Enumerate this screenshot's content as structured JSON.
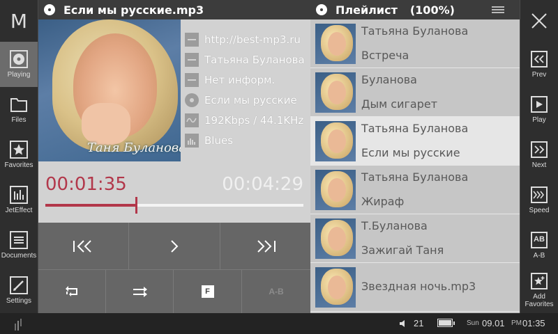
{
  "app": {
    "logo": "M"
  },
  "header": {
    "track_title": "Если мы русские.mp3",
    "playlist_label": "Плейлист",
    "playlist_percent": "(100%)"
  },
  "left_nav": [
    {
      "label": "Playing",
      "icon": "disc-icon",
      "active": true
    },
    {
      "label": "Files",
      "icon": "folder-icon"
    },
    {
      "label": "Favorites",
      "icon": "star-icon"
    },
    {
      "label": "JetEffect",
      "icon": "equalizer-icon"
    },
    {
      "label": "Documents",
      "icon": "document-icon"
    },
    {
      "label": "Settings",
      "icon": "pencil-icon"
    }
  ],
  "now_playing": {
    "art_caption": "Таня Буланова",
    "meta": [
      {
        "icon": "dash-icon",
        "text": "http://best-mp3.ru"
      },
      {
        "icon": "dash-icon",
        "text": "Татьяна Буланова"
      },
      {
        "icon": "dash-icon",
        "text": "Нет информ."
      },
      {
        "icon": "disc-icon",
        "text": "Если мы русские"
      },
      {
        "icon": "wave-icon",
        "text": "192Kbps / 44.1KHz"
      },
      {
        "icon": "eq-bars-icon",
        "text": "Blues"
      }
    ],
    "time_current": "00:01:35",
    "time_total": "00:04:29",
    "progress": 0.35
  },
  "controls": {
    "f_label": "F",
    "ab_label": "A-B"
  },
  "playlist": [
    {
      "line1": "Татьяна Буланова",
      "line2": "Встреча"
    },
    {
      "line1": "Буланова",
      "line2": "Дым сигарет"
    },
    {
      "line1": "Татьяна Буланова",
      "line2": "Если мы русские",
      "current": true
    },
    {
      "line1": "Татьяна Буланова",
      "line2": "Жираф"
    },
    {
      "line1": "Т.Буланова",
      "line2": "Зажигай Таня"
    },
    {
      "single": "Звездная ночь.mp3"
    }
  ],
  "right_nav": [
    {
      "label": "Prev",
      "icon": "prev-icon"
    },
    {
      "label": "Play",
      "icon": "play-icon"
    },
    {
      "label": "Next",
      "icon": "next-icon"
    },
    {
      "label": "Speed",
      "icon": "speed-icon"
    },
    {
      "label": "A-B",
      "box_text": "AB"
    },
    {
      "label": "Add Favorites",
      "icon": "add-favorite-icon"
    }
  ],
  "status_bar": {
    "volume": "21",
    "battery_level": 1.0,
    "day": "Sun",
    "date": "09.01",
    "ampm": "PM",
    "time": "01:35"
  }
}
